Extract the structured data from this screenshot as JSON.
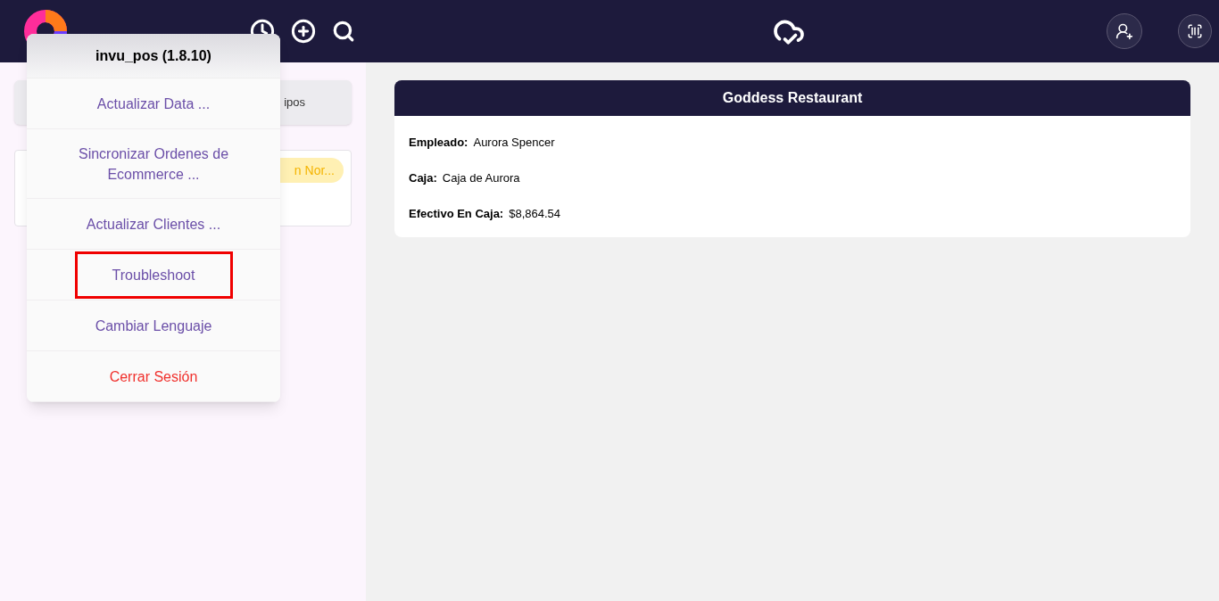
{
  "left_panel": {
    "tab_text": "ipos",
    "order_card": {
      "badge": "n Nor..."
    }
  },
  "menu": {
    "title": "invu_pos (1.8.10)",
    "items": [
      {
        "label": "Actualizar Data ...",
        "kind": "normal",
        "highlighted": false
      },
      {
        "label": "Sincronizar Ordenes de Ecommerce ...",
        "kind": "normal",
        "highlighted": false
      },
      {
        "label": "Actualizar Clientes ...",
        "kind": "normal",
        "highlighted": false
      },
      {
        "label": "Troubleshoot",
        "kind": "normal",
        "highlighted": true
      },
      {
        "label": "Cambiar Lenguaje",
        "kind": "normal",
        "highlighted": false
      },
      {
        "label": "Cerrar Sesión",
        "kind": "danger",
        "highlighted": false
      }
    ]
  },
  "info_card": {
    "title": "Goddess Restaurant",
    "fields": [
      {
        "label": "Empleado:",
        "value": "Aurora Spencer"
      },
      {
        "label": "Caja:",
        "value": "Caja de Aurora"
      },
      {
        "label": "Efectivo En Caja:",
        "value": "$8,864.54"
      }
    ]
  }
}
